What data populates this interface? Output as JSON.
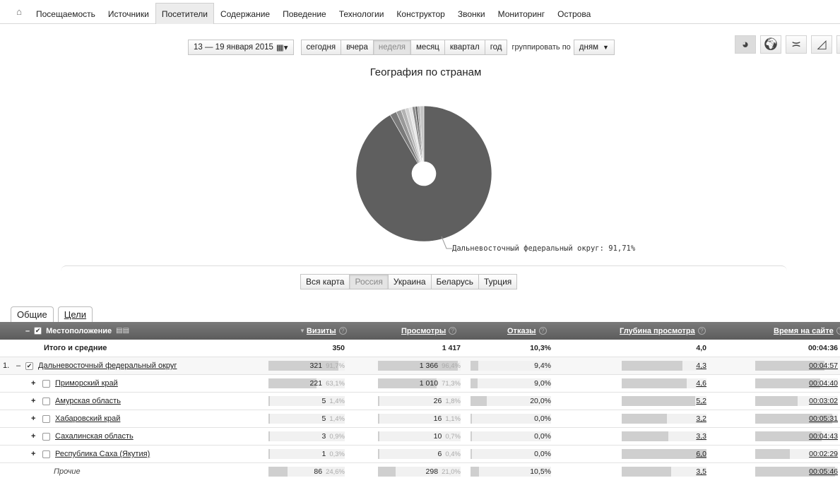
{
  "nav": {
    "home_icon": "home-icon",
    "items": [
      {
        "label": "Посещаемость",
        "active": false
      },
      {
        "label": "Источники",
        "active": false
      },
      {
        "label": "Посетители",
        "active": true
      },
      {
        "label": "Содержание",
        "active": false
      },
      {
        "label": "Поведение",
        "active": false
      },
      {
        "label": "Технологии",
        "active": false
      },
      {
        "label": "Конструктор",
        "active": false
      },
      {
        "label": "Звонки",
        "active": false
      },
      {
        "label": "Мониторинг",
        "active": false
      },
      {
        "label": "Острова",
        "active": false
      }
    ]
  },
  "toolbar": {
    "date_range": "13 — 19 января 2015",
    "periods": [
      "сегодня",
      "вчера",
      "неделя",
      "месяц",
      "квартал",
      "год"
    ],
    "selected_period": "неделя",
    "group_label": "группировать по",
    "group_value": "дням"
  },
  "view_icons": [
    "pie-chart-icon",
    "world-map-icon",
    "line-chart-icon",
    "area-chart-icon",
    "bar-chart-icon"
  ],
  "chart_data": {
    "type": "pie",
    "title": "География по странам",
    "label": "Дальневосточный федеральный округ: 91,71%",
    "values": [
      91.71,
      1.6,
      1.2,
      1.0,
      0.9,
      0.8,
      0.7,
      0.6,
      0.5,
      0.99
    ],
    "colors": [
      "#5f5f5f",
      "#7a7a7a",
      "#999999",
      "#b3b3b3",
      "#d2d2d2",
      "#e6e6e6",
      "#8a8a8a",
      "#6c6c6c",
      "#a8a8a8",
      "#c4c4c4"
    ]
  },
  "map_tabs": {
    "items": [
      "Вся карта",
      "Россия",
      "Украина",
      "Беларусь",
      "Турция"
    ],
    "selected": "Россия"
  },
  "section_tabs": [
    "Общие",
    "Цели"
  ],
  "table": {
    "headers": {
      "location": "Местоположение",
      "visits": "Визиты",
      "views": "Просмотры",
      "bounces": "Отказы",
      "depth": "Глубина просмотра",
      "time": "Время на сайте"
    },
    "total": {
      "label": "Итого и средние",
      "visits": "350",
      "views": "1 417",
      "bounces": "10,3%",
      "depth": "4,0",
      "time": "00:04:36"
    },
    "rows": [
      {
        "index": "1.",
        "toggle": "–",
        "checked": true,
        "name": "Дальневосточный федеральный округ",
        "level": 1,
        "visits": "321",
        "visits_pct": "91,7%",
        "visits_frac": 0.917,
        "views": "1 366",
        "views_pct": "96,4%",
        "views_frac": 0.964,
        "bounces": "9,4%",
        "bounces_frac": 0.094,
        "depth": "4,3",
        "depth_frac": 0.717,
        "time": "00:04:57",
        "time_frac": 0.84
      },
      {
        "toggle": "+",
        "checked": false,
        "name": "Приморский край",
        "level": 2,
        "visits": "221",
        "visits_pct": "63,1%",
        "visits_frac": 0.631,
        "views": "1 010",
        "views_pct": "71,3%",
        "views_frac": 0.713,
        "bounces": "9,0%",
        "bounces_frac": 0.09,
        "depth": "4,6",
        "depth_frac": 0.767,
        "time": "00:04:40",
        "time_frac": 0.79
      },
      {
        "toggle": "+",
        "checked": false,
        "name": "Амурская область",
        "level": 2,
        "visits": "5",
        "visits_pct": "1,4%",
        "visits_frac": 0.014,
        "views": "26",
        "views_pct": "1,8%",
        "views_frac": 0.018,
        "bounces": "20,0%",
        "bounces_frac": 0.2,
        "depth": "5,2",
        "depth_frac": 0.867,
        "time": "00:03:02",
        "time_frac": 0.51
      },
      {
        "toggle": "+",
        "checked": false,
        "name": "Хабаровский край",
        "level": 2,
        "visits": "5",
        "visits_pct": "1,4%",
        "visits_frac": 0.014,
        "views": "16",
        "views_pct": "1,1%",
        "views_frac": 0.011,
        "bounces": "0,0%",
        "bounces_frac": 0,
        "depth": "3,2",
        "depth_frac": 0.533,
        "time": "00:05:31",
        "time_frac": 0.93
      },
      {
        "toggle": "+",
        "checked": false,
        "name": "Сахалинская область",
        "level": 2,
        "visits": "3",
        "visits_pct": "0,9%",
        "visits_frac": 0.009,
        "views": "10",
        "views_pct": "0,7%",
        "views_frac": 0.007,
        "bounces": "0,0%",
        "bounces_frac": 0,
        "depth": "3,3",
        "depth_frac": 0.55,
        "time": "00:04:43",
        "time_frac": 0.8
      },
      {
        "toggle": "+",
        "checked": false,
        "name": "Республика Саха (Якутия)",
        "level": 2,
        "visits": "1",
        "visits_pct": "0,3%",
        "visits_frac": 0.003,
        "views": "6",
        "views_pct": "0,4%",
        "views_frac": 0.004,
        "bounces": "0,0%",
        "bounces_frac": 0,
        "depth": "6,0",
        "depth_frac": 1.0,
        "time": "00:02:29",
        "time_frac": 0.42
      },
      {
        "toggle": "",
        "checked": null,
        "name": "Прочие",
        "level": 2,
        "other": true,
        "visits": "86",
        "visits_pct": "24,6%",
        "visits_frac": 0.246,
        "views": "298",
        "views_pct": "21,0%",
        "views_frac": 0.21,
        "bounces": "10,5%",
        "bounces_frac": 0.105,
        "depth": "3,5",
        "depth_frac": 0.583,
        "time": "00:05:46",
        "time_frac": 0.97
      }
    ]
  }
}
